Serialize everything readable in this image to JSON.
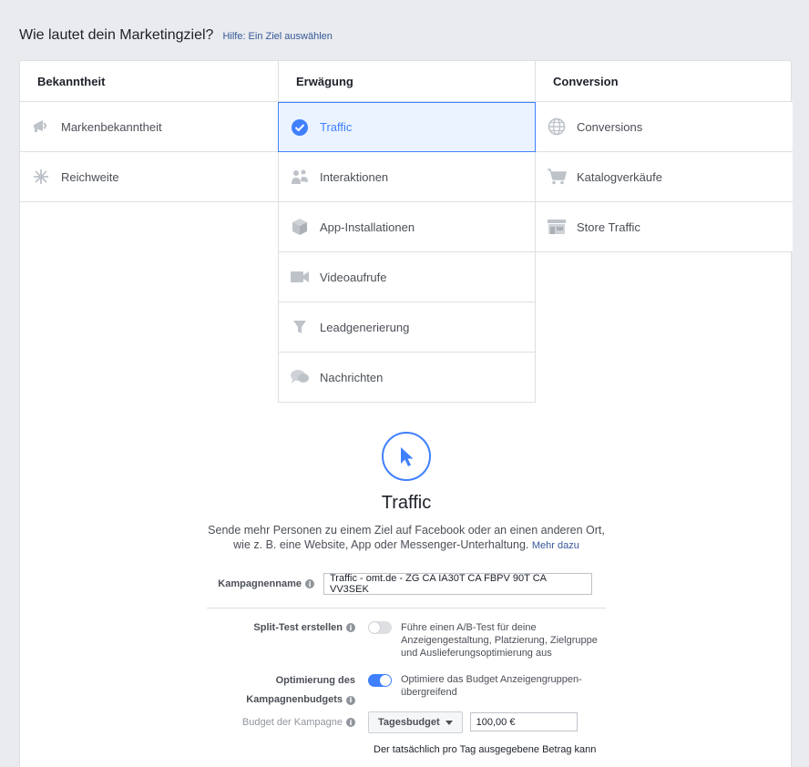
{
  "header": {
    "title": "Wie lautet dein Marketingziel?",
    "help_link": "Hilfe: Ein Ziel auswählen"
  },
  "columns": [
    {
      "heading": "Bekanntheit",
      "items": [
        {
          "label": "Markenbekanntheit",
          "icon": "megaphone-icon"
        },
        {
          "label": "Reichweite",
          "icon": "reach-icon"
        }
      ]
    },
    {
      "heading": "Erwägung",
      "items": [
        {
          "label": "Traffic",
          "icon": "check-circle-icon",
          "selected": true
        },
        {
          "label": "Interaktionen",
          "icon": "people-icon"
        },
        {
          "label": "App-Installationen",
          "icon": "box-icon"
        },
        {
          "label": "Videoaufrufe",
          "icon": "video-camera-icon"
        },
        {
          "label": "Leadgenerierung",
          "icon": "funnel-icon"
        },
        {
          "label": "Nachrichten",
          "icon": "chat-bubbles-icon"
        }
      ]
    },
    {
      "heading": "Conversion",
      "items": [
        {
          "label": "Conversions",
          "icon": "globe-icon"
        },
        {
          "label": "Katalogverkäufe",
          "icon": "shopping-cart-icon"
        },
        {
          "label": "Store Traffic",
          "icon": "store-icon"
        }
      ]
    }
  ],
  "detail": {
    "icon": "cursor-icon",
    "title": "Traffic",
    "description_line1": "Sende mehr Personen zu einem Ziel auf Facebook oder an einen anderen Ort,",
    "description_line2": "wie z. B. eine Website, App oder Messenger-Unterhaltung.",
    "more_link": "Mehr dazu"
  },
  "form": {
    "campaign_name_label": "Kampagnenname",
    "campaign_name_value": "Traffic - omt.de - ZG CA IA30T CA FBPV 90T CA VV3SEK",
    "split_test_label": "Split-Test erstellen",
    "split_test_text": "Führe einen A/B-Test für deine Anzeigengestaltung, Platzierung, Zielgruppe und Auslieferungsoptimierung aus",
    "split_test_on": false,
    "budget_opt_label_line1": "Optimierung des",
    "budget_opt_label_line2": "Kampagnenbudgets",
    "budget_opt_text": "Optimiere das Budget Anzeigengruppen-übergreifend",
    "budget_opt_on": true,
    "budget_label": "Budget der Kampagne",
    "budget_type": "Tagesbudget",
    "budget_value": "100,00 €",
    "footnote": "Der tatsächlich pro Tag ausgegebene Betrag kann"
  },
  "colors": {
    "accent": "#4080ff",
    "link": "#365899",
    "background": "#e9ebee"
  }
}
